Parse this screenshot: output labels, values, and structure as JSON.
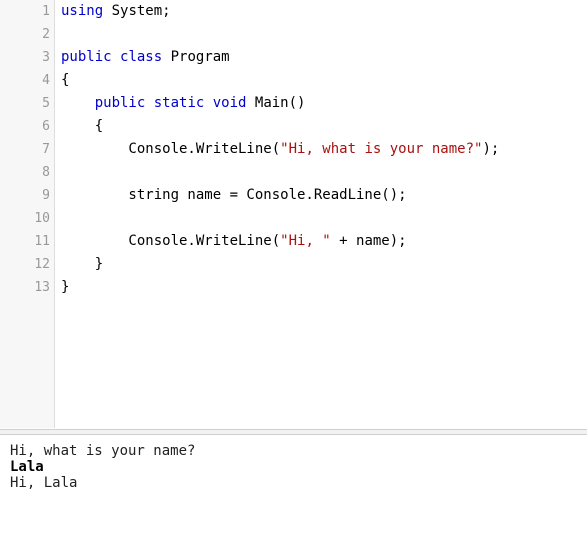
{
  "editor": {
    "lines": [
      {
        "num": "1",
        "t": [
          {
            "k": "kw",
            "v": "using"
          },
          {
            "k": "",
            "v": " System;"
          }
        ]
      },
      {
        "num": "2",
        "t": []
      },
      {
        "num": "3",
        "t": [
          {
            "k": "kw",
            "v": "public"
          },
          {
            "k": "",
            "v": " "
          },
          {
            "k": "kw",
            "v": "class"
          },
          {
            "k": "",
            "v": " Program"
          }
        ]
      },
      {
        "num": "4",
        "t": [
          {
            "k": "",
            "v": "{"
          }
        ]
      },
      {
        "num": "5",
        "t": [
          {
            "k": "",
            "v": "    "
          },
          {
            "k": "kw",
            "v": "public"
          },
          {
            "k": "",
            "v": " "
          },
          {
            "k": "kw",
            "v": "static"
          },
          {
            "k": "",
            "v": " "
          },
          {
            "k": "kw",
            "v": "void"
          },
          {
            "k": "",
            "v": " Main()"
          }
        ]
      },
      {
        "num": "6",
        "t": [
          {
            "k": "",
            "v": "    {"
          }
        ]
      },
      {
        "num": "7",
        "t": [
          {
            "k": "",
            "v": "        Console.WriteLine("
          },
          {
            "k": "str",
            "v": "\"Hi, what is your name?\""
          },
          {
            "k": "",
            "v": ");"
          }
        ]
      },
      {
        "num": "8",
        "t": []
      },
      {
        "num": "9",
        "t": [
          {
            "k": "",
            "v": "        string name = Console.ReadLine();"
          }
        ]
      },
      {
        "num": "10",
        "t": []
      },
      {
        "num": "11",
        "t": [
          {
            "k": "",
            "v": "        Console.WriteLine("
          },
          {
            "k": "str",
            "v": "\"Hi, \""
          },
          {
            "k": "",
            "v": " + name);"
          }
        ]
      },
      {
        "num": "12",
        "t": [
          {
            "k": "",
            "v": "    }"
          }
        ]
      },
      {
        "num": "13",
        "t": [
          {
            "k": "",
            "v": "}"
          }
        ]
      }
    ]
  },
  "console": {
    "lines": [
      {
        "text": "Hi, what is your name?",
        "kind": "output"
      },
      {
        "text": "Lala",
        "kind": "input"
      },
      {
        "text": "Hi, Lala",
        "kind": "output"
      }
    ]
  }
}
